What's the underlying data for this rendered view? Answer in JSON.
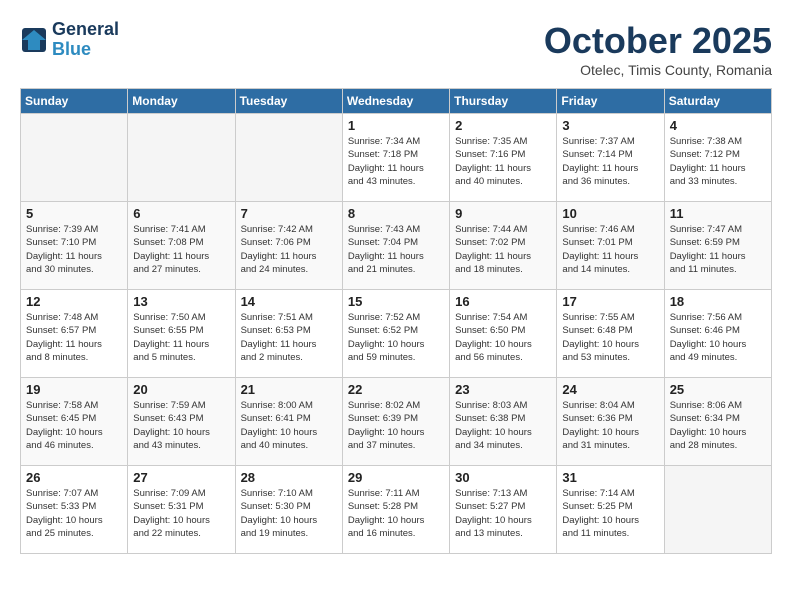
{
  "logo": {
    "line1": "General",
    "line2": "Blue"
  },
  "title": "October 2025",
  "subtitle": "Otelec, Timis County, Romania",
  "days_of_week": [
    "Sunday",
    "Monday",
    "Tuesday",
    "Wednesday",
    "Thursday",
    "Friday",
    "Saturday"
  ],
  "weeks": [
    [
      {
        "day": "",
        "info": ""
      },
      {
        "day": "",
        "info": ""
      },
      {
        "day": "",
        "info": ""
      },
      {
        "day": "1",
        "info": "Sunrise: 7:34 AM\nSunset: 7:18 PM\nDaylight: 11 hours\nand 43 minutes."
      },
      {
        "day": "2",
        "info": "Sunrise: 7:35 AM\nSunset: 7:16 PM\nDaylight: 11 hours\nand 40 minutes."
      },
      {
        "day": "3",
        "info": "Sunrise: 7:37 AM\nSunset: 7:14 PM\nDaylight: 11 hours\nand 36 minutes."
      },
      {
        "day": "4",
        "info": "Sunrise: 7:38 AM\nSunset: 7:12 PM\nDaylight: 11 hours\nand 33 minutes."
      }
    ],
    [
      {
        "day": "5",
        "info": "Sunrise: 7:39 AM\nSunset: 7:10 PM\nDaylight: 11 hours\nand 30 minutes."
      },
      {
        "day": "6",
        "info": "Sunrise: 7:41 AM\nSunset: 7:08 PM\nDaylight: 11 hours\nand 27 minutes."
      },
      {
        "day": "7",
        "info": "Sunrise: 7:42 AM\nSunset: 7:06 PM\nDaylight: 11 hours\nand 24 minutes."
      },
      {
        "day": "8",
        "info": "Sunrise: 7:43 AM\nSunset: 7:04 PM\nDaylight: 11 hours\nand 21 minutes."
      },
      {
        "day": "9",
        "info": "Sunrise: 7:44 AM\nSunset: 7:02 PM\nDaylight: 11 hours\nand 18 minutes."
      },
      {
        "day": "10",
        "info": "Sunrise: 7:46 AM\nSunset: 7:01 PM\nDaylight: 11 hours\nand 14 minutes."
      },
      {
        "day": "11",
        "info": "Sunrise: 7:47 AM\nSunset: 6:59 PM\nDaylight: 11 hours\nand 11 minutes."
      }
    ],
    [
      {
        "day": "12",
        "info": "Sunrise: 7:48 AM\nSunset: 6:57 PM\nDaylight: 11 hours\nand 8 minutes."
      },
      {
        "day": "13",
        "info": "Sunrise: 7:50 AM\nSunset: 6:55 PM\nDaylight: 11 hours\nand 5 minutes."
      },
      {
        "day": "14",
        "info": "Sunrise: 7:51 AM\nSunset: 6:53 PM\nDaylight: 11 hours\nand 2 minutes."
      },
      {
        "day": "15",
        "info": "Sunrise: 7:52 AM\nSunset: 6:52 PM\nDaylight: 10 hours\nand 59 minutes."
      },
      {
        "day": "16",
        "info": "Sunrise: 7:54 AM\nSunset: 6:50 PM\nDaylight: 10 hours\nand 56 minutes."
      },
      {
        "day": "17",
        "info": "Sunrise: 7:55 AM\nSunset: 6:48 PM\nDaylight: 10 hours\nand 53 minutes."
      },
      {
        "day": "18",
        "info": "Sunrise: 7:56 AM\nSunset: 6:46 PM\nDaylight: 10 hours\nand 49 minutes."
      }
    ],
    [
      {
        "day": "19",
        "info": "Sunrise: 7:58 AM\nSunset: 6:45 PM\nDaylight: 10 hours\nand 46 minutes."
      },
      {
        "day": "20",
        "info": "Sunrise: 7:59 AM\nSunset: 6:43 PM\nDaylight: 10 hours\nand 43 minutes."
      },
      {
        "day": "21",
        "info": "Sunrise: 8:00 AM\nSunset: 6:41 PM\nDaylight: 10 hours\nand 40 minutes."
      },
      {
        "day": "22",
        "info": "Sunrise: 8:02 AM\nSunset: 6:39 PM\nDaylight: 10 hours\nand 37 minutes."
      },
      {
        "day": "23",
        "info": "Sunrise: 8:03 AM\nSunset: 6:38 PM\nDaylight: 10 hours\nand 34 minutes."
      },
      {
        "day": "24",
        "info": "Sunrise: 8:04 AM\nSunset: 6:36 PM\nDaylight: 10 hours\nand 31 minutes."
      },
      {
        "day": "25",
        "info": "Sunrise: 8:06 AM\nSunset: 6:34 PM\nDaylight: 10 hours\nand 28 minutes."
      }
    ],
    [
      {
        "day": "26",
        "info": "Sunrise: 7:07 AM\nSunset: 5:33 PM\nDaylight: 10 hours\nand 25 minutes."
      },
      {
        "day": "27",
        "info": "Sunrise: 7:09 AM\nSunset: 5:31 PM\nDaylight: 10 hours\nand 22 minutes."
      },
      {
        "day": "28",
        "info": "Sunrise: 7:10 AM\nSunset: 5:30 PM\nDaylight: 10 hours\nand 19 minutes."
      },
      {
        "day": "29",
        "info": "Sunrise: 7:11 AM\nSunset: 5:28 PM\nDaylight: 10 hours\nand 16 minutes."
      },
      {
        "day": "30",
        "info": "Sunrise: 7:13 AM\nSunset: 5:27 PM\nDaylight: 10 hours\nand 13 minutes."
      },
      {
        "day": "31",
        "info": "Sunrise: 7:14 AM\nSunset: 5:25 PM\nDaylight: 10 hours\nand 11 minutes."
      },
      {
        "day": "",
        "info": ""
      }
    ]
  ]
}
